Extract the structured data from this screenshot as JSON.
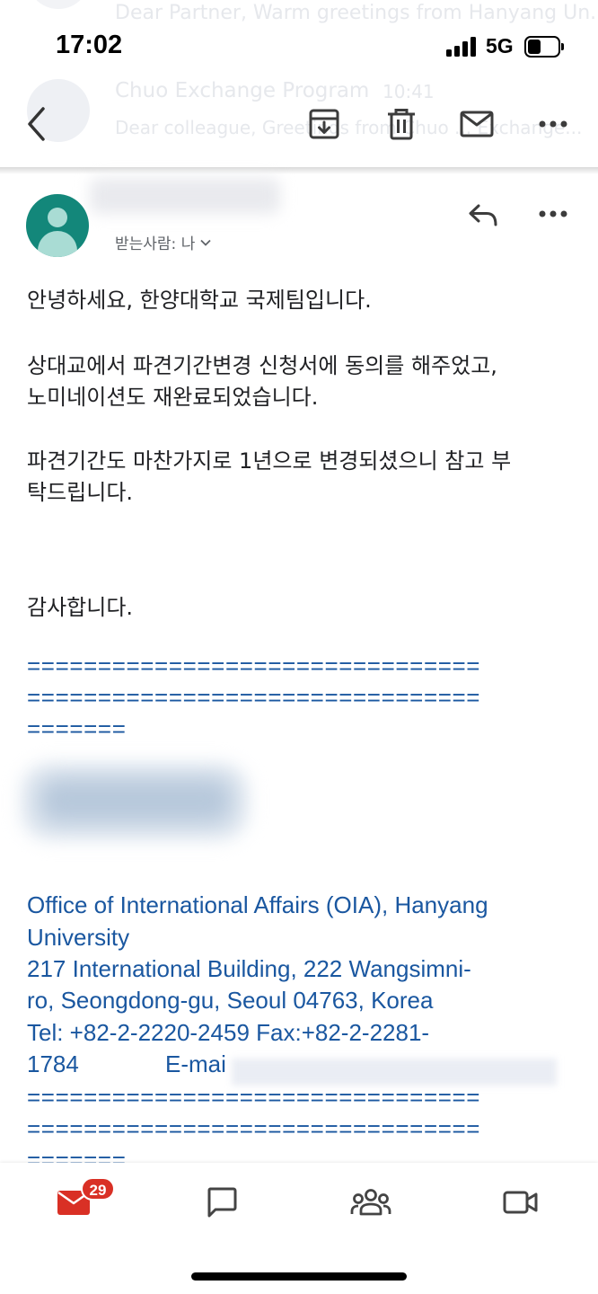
{
  "background_list": {
    "row1_preview": "Dear Partner, Warm greetings from Hanyang Un...",
    "row2_sender": "Chuo Exchange Program",
    "row2_time": "10:41",
    "row2_preview": "Dear colleague, Greetings from Chuo ... Exchange..."
  },
  "status_bar": {
    "time": "17:02",
    "network": "5G",
    "battery_level": 0.45
  },
  "toolbar": {
    "back_icon": "chevron-left-icon",
    "archive_icon": "archive-icon",
    "delete_icon": "trash-icon",
    "mark_unread_icon": "envelope-icon",
    "more_icon": "more-horizontal-icon"
  },
  "message": {
    "recipients_label": "받는사람: 나",
    "body": {
      "greeting": "안녕하세요, 한양대학교 국제팀입니다.",
      "para1_line1": "상대교에서 파견기간변경 신청서에 동의를 해주었고,",
      "para1_line2": "노미네이션도 재완료되었습니다.",
      "para2_line1": "파견기간도 마찬가지로 1년으로 변경되셨으니 참고 부",
      "para2_line2": "탁드립니다.",
      "closing": "감사합니다."
    },
    "signature": {
      "divider_line1": "================================",
      "divider_line2": "================================",
      "divider_line3": "=======",
      "line1": "Office of International Affairs (OIA), Hanyang",
      "line2": "University",
      "line3": "217 International Building, 222 Wangsimni-",
      "line4": "ro, Seongdong-gu, Seoul 04763, Korea",
      "line5": "Tel: +82-2-2220-2459           Fax:+82-2-2281-",
      "line6_a": "1784",
      "line6_b": "E-mai",
      "divider2_line1": "================================",
      "divider2_line2": "================================",
      "divider2_line3": "======="
    }
  },
  "bottom_nav": {
    "mail_badge": "29",
    "items": [
      "mail-icon",
      "chat-icon",
      "spaces-icon",
      "meet-icon"
    ]
  },
  "colors": {
    "accent_red": "#d93025",
    "link_blue": "#1a57a0",
    "avatar_teal": "#13877a"
  }
}
